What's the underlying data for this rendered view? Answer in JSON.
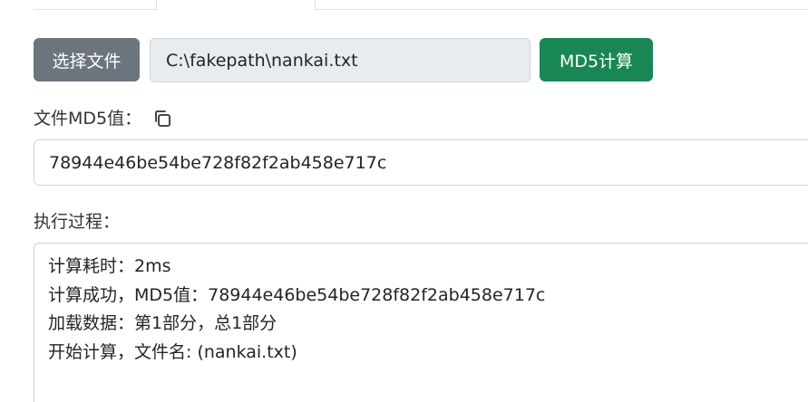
{
  "file_row": {
    "choose_button": "选择文件",
    "file_path": "C:\\fakepath\\nankai.txt",
    "md5_button": "MD5计算"
  },
  "md5": {
    "label": "文件MD5值：",
    "copy_icon": "copy-icon",
    "value": "78944e46be54be728f82f2ab458e717c"
  },
  "process": {
    "label": "执行过程：",
    "log_lines": [
      "计算耗时：2ms",
      "计算成功，MD5值：78944e46be54be728f82f2ab458e717c",
      "加载数据：第1部分，总1部分",
      "开始计算，文件名: (nankai.txt)"
    ]
  },
  "colors": {
    "secondary_button": "#6c757d",
    "success_button": "#198754",
    "readonly_bg": "#e9ecef",
    "border": "#ced4da"
  }
}
